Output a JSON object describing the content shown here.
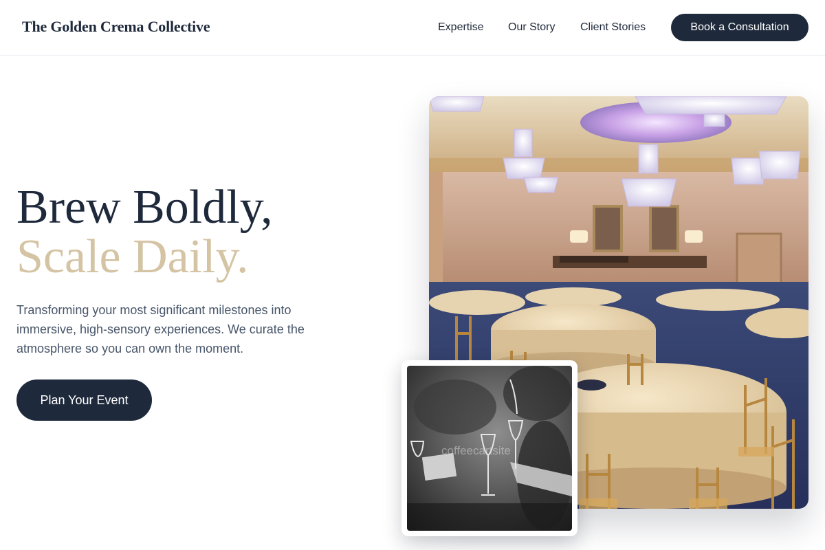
{
  "header": {
    "brand": "The Golden Crema Collective",
    "nav": [
      {
        "label": "Expertise"
      },
      {
        "label": "Our Story"
      },
      {
        "label": "Client Stories"
      }
    ],
    "cta_label": "Book a Consultation"
  },
  "hero": {
    "title_line1": "Brew Boldly,",
    "title_line2": "Scale Daily.",
    "description": "Transforming your most significant milestones into immersive, high-sensory experiences. We curate the atmosphere so you can own the moment.",
    "cta_label": "Plan Your Event"
  },
  "images": {
    "main_alt": "Elegant banquet hall with crystal chandeliers, round tables with gold tablecloths and gold chiavari chairs",
    "inset_alt": "Black and white photo of guests raising champagne glasses",
    "inset_watermark": "coffeecartsite"
  },
  "colors": {
    "primary": "#1e293b",
    "accent": "#d4c4a4",
    "body_text": "#475569",
    "background": "#ffffff"
  }
}
